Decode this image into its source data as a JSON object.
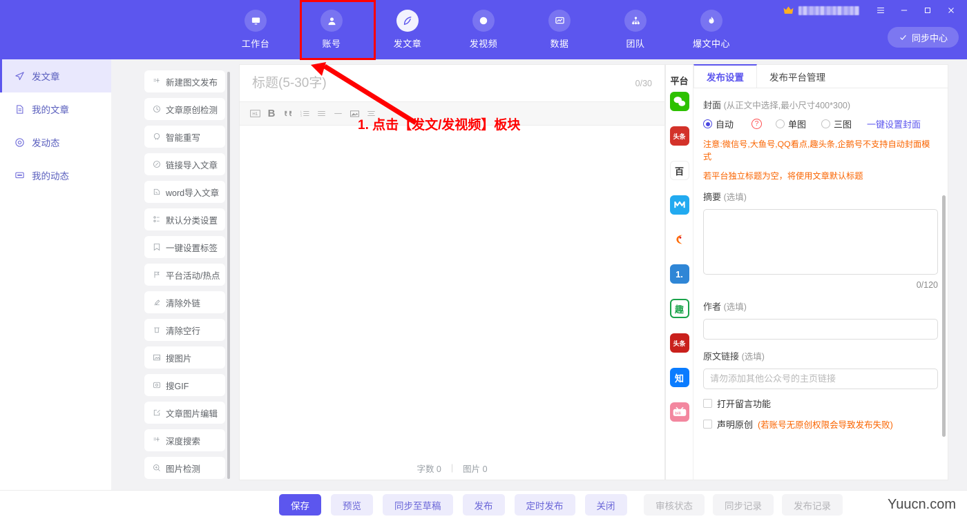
{
  "header": {
    "nav": [
      {
        "label": "工作台",
        "icon": "monitor-icon"
      },
      {
        "label": "账号",
        "icon": "user-icon"
      },
      {
        "label": "发文章",
        "icon": "feather-pen-icon"
      },
      {
        "label": "发视频",
        "icon": "play-circle-icon"
      },
      {
        "label": "数据",
        "icon": "chart-icon"
      },
      {
        "label": "团队",
        "icon": "team-icon"
      },
      {
        "label": "爆文中心",
        "icon": "flame-icon"
      }
    ],
    "active_index": 2,
    "sync_button": "同步中心",
    "brand_color": "#5c56ee",
    "highlight_color": "#ff0000",
    "window_controls": [
      "menu-icon",
      "minimize-icon",
      "maximize-icon",
      "close-icon"
    ]
  },
  "sidebar": {
    "items": [
      {
        "label": "发文章",
        "icon": "send-icon",
        "active": true
      },
      {
        "label": "我的文章",
        "icon": "document-icon",
        "active": false
      },
      {
        "label": "发动态",
        "icon": "target-icon",
        "active": false
      },
      {
        "label": "我的动态",
        "icon": "comment-icon",
        "active": false
      }
    ]
  },
  "toollist": {
    "items": [
      {
        "label": "新建图文发布",
        "icon": "new-post-icon"
      },
      {
        "label": "文章原创检测",
        "icon": "originality-check-icon"
      },
      {
        "label": "智能重写",
        "icon": "ai-rewrite-icon"
      },
      {
        "label": "链接导入文章",
        "icon": "link-import-icon"
      },
      {
        "label": "word导入文章",
        "icon": "word-import-icon"
      },
      {
        "label": "默认分类设置",
        "icon": "category-icon"
      },
      {
        "label": "一键设置标签",
        "icon": "tag-icon"
      },
      {
        "label": "平台活动/热点",
        "icon": "flag-icon"
      },
      {
        "label": "清除外链",
        "icon": "clear-link-icon"
      },
      {
        "label": "清除空行",
        "icon": "clear-blank-icon"
      },
      {
        "label": "搜图片",
        "icon": "search-image-icon"
      },
      {
        "label": "搜GIF",
        "icon": "search-gif-icon"
      },
      {
        "label": "文章图片编辑",
        "icon": "edit-image-icon"
      },
      {
        "label": "深度搜索",
        "icon": "deep-search-icon"
      },
      {
        "label": "图片检测",
        "icon": "image-detect-icon"
      }
    ]
  },
  "editor": {
    "title_value": "",
    "title_placeholder": "标题(5-30字)",
    "title_count": "0/30",
    "toolbar_icons": [
      "heading-icon",
      "bold-icon",
      "quote-icon",
      "ordered-list-icon",
      "bullet-list-icon",
      "horizontal-rule-icon",
      "image-icon",
      "align-icon"
    ],
    "status": {
      "words_label": "字数 0",
      "separator": "|",
      "images_label": "图片 0"
    }
  },
  "right_panel": {
    "platform_column_title": "平台",
    "platforms": [
      {
        "name": "wechat",
        "glyph": "",
        "bg": "#2dc100",
        "selected": true
      },
      {
        "name": "toutiao",
        "glyph": "头条",
        "bg": "#d3322a",
        "selected": false
      },
      {
        "name": "baijiahao",
        "glyph": "百",
        "bg": "#ffffff",
        "selected": false
      },
      {
        "name": "dayuhao",
        "glyph": "M",
        "bg": "#22aaf0",
        "selected": false
      },
      {
        "name": "sohuhao",
        "glyph": "",
        "bg": "#ffffff",
        "selected": false
      },
      {
        "name": "yidianzixun",
        "glyph": "1.",
        "bg": "#2f86d6",
        "selected": false
      },
      {
        "name": "qutoutiao",
        "glyph": "趣",
        "bg": "#ffffff",
        "selected": false
      },
      {
        "name": "toutiao-alt",
        "glyph": "头条",
        "bg": "#c9201c",
        "selected": false
      },
      {
        "name": "zhihu",
        "glyph": "知",
        "bg": "#0a7cff",
        "selected": false
      },
      {
        "name": "bilibili",
        "glyph": "bili",
        "bg": "#f3879f",
        "selected": false
      }
    ],
    "tabs": [
      {
        "label": "发布设置",
        "active": true
      },
      {
        "label": "发布平台管理",
        "active": false
      }
    ],
    "cover": {
      "label": "封面",
      "hint": "(从正文中选择,最小尺寸400*300)",
      "options": [
        {
          "label": "自动",
          "checked": true
        },
        {
          "label": "单图",
          "checked": false
        },
        {
          "label": "三图",
          "checked": false
        }
      ],
      "help_icon": "question-mark-icon",
      "action_link": "一键设置封面"
    },
    "warnings": [
      "注意:微信号,大鱼号,QQ看点,趣头条,企鹅号不支持自动封面模式",
      "若平台独立标题为空，将使用文章默认标题"
    ],
    "summary": {
      "label": "摘要",
      "optional": "(选填)",
      "value": "",
      "count": "0/120"
    },
    "author": {
      "label": "作者",
      "optional": "(选填)",
      "value": ""
    },
    "source_link": {
      "label": "原文链接",
      "optional": "(选填)",
      "value": "",
      "placeholder": "请勿添加其他公众号的主页链接"
    },
    "checkboxes": [
      {
        "label": "打开留言功能",
        "note": "",
        "checked": false
      },
      {
        "label": "声明原创",
        "note": "(若账号无原创权限会导致发布失败)",
        "checked": false
      }
    ]
  },
  "bottom_bar": {
    "left_buttons": [
      {
        "label": "保存",
        "style": "primary"
      },
      {
        "label": "预览",
        "style": "secondary"
      },
      {
        "label": "同步至草稿",
        "style": "secondary"
      },
      {
        "label": "发布",
        "style": "secondary"
      },
      {
        "label": "定时发布",
        "style": "secondary"
      },
      {
        "label": "关闭",
        "style": "secondary"
      }
    ],
    "right_buttons": [
      {
        "label": "审核状态",
        "style": "ghost"
      },
      {
        "label": "同步记录",
        "style": "ghost"
      },
      {
        "label": "发布记录",
        "style": "ghost"
      }
    ],
    "watermark": "Yuucn.com"
  },
  "annotation": {
    "text": "1. 点击【发文/发视频】板块",
    "color": "#ff0000"
  }
}
